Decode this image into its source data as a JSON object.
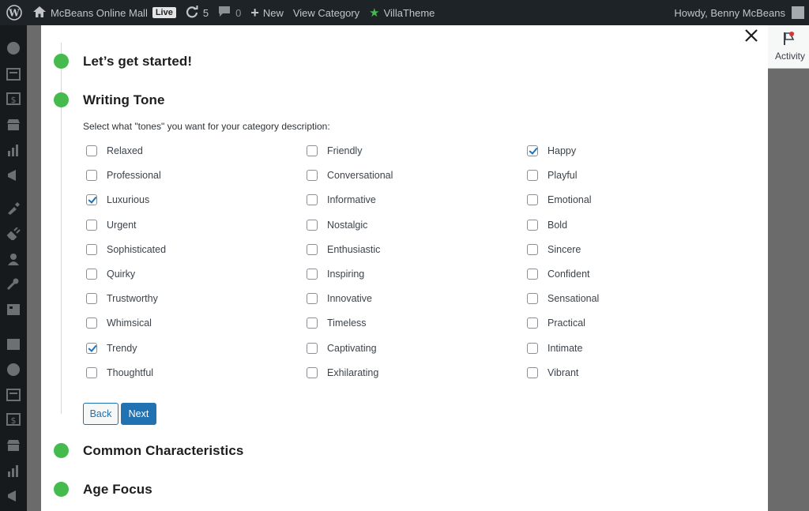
{
  "admin_bar": {
    "site_name": "McBeans Online Mall",
    "live_badge": "Live",
    "updates_count": "5",
    "comments_count": "0",
    "new_label": "New",
    "view_category_label": "View Category",
    "plugin_label": "VillaTheme",
    "greeting": "Howdy, Benny McBeans"
  },
  "background": {
    "activity_label": "Activity"
  },
  "wizard": {
    "steps": [
      {
        "title": "Let’s get started!"
      },
      {
        "title": "Writing Tone"
      },
      {
        "title": "Common Characteristics"
      },
      {
        "title": "Age Focus"
      }
    ],
    "intro": "Select what \"tones\" you want for your category description:",
    "tones": [
      {
        "label": "Relaxed",
        "checked": false
      },
      {
        "label": "Friendly",
        "checked": false
      },
      {
        "label": "Happy",
        "checked": true
      },
      {
        "label": "Professional",
        "checked": false
      },
      {
        "label": "Conversational",
        "checked": false
      },
      {
        "label": "Playful",
        "checked": false
      },
      {
        "label": "Luxurious",
        "checked": true
      },
      {
        "label": "Informative",
        "checked": false
      },
      {
        "label": "Emotional",
        "checked": false
      },
      {
        "label": "Urgent",
        "checked": false
      },
      {
        "label": "Nostalgic",
        "checked": false
      },
      {
        "label": "Bold",
        "checked": false
      },
      {
        "label": "Sophisticated",
        "checked": false
      },
      {
        "label": "Enthusiastic",
        "checked": false
      },
      {
        "label": "Sincere",
        "checked": false
      },
      {
        "label": "Quirky",
        "checked": false
      },
      {
        "label": "Inspiring",
        "checked": false
      },
      {
        "label": "Confident",
        "checked": false
      },
      {
        "label": "Trustworthy",
        "checked": false
      },
      {
        "label": "Innovative",
        "checked": false
      },
      {
        "label": "Sensational",
        "checked": false
      },
      {
        "label": "Whimsical",
        "checked": false
      },
      {
        "label": "Timeless",
        "checked": false
      },
      {
        "label": "Practical",
        "checked": false
      },
      {
        "label": "Trendy",
        "checked": true
      },
      {
        "label": "Captivating",
        "checked": false
      },
      {
        "label": "Intimate",
        "checked": false
      },
      {
        "label": "Thoughtful",
        "checked": false
      },
      {
        "label": "Exhilarating",
        "checked": false
      },
      {
        "label": "Vibrant",
        "checked": false
      }
    ],
    "back_label": "Back",
    "next_label": "Next"
  },
  "colors": {
    "accent": "#2271b1",
    "step_dot": "#45bb4e",
    "admin_bar": "#1d2327"
  }
}
